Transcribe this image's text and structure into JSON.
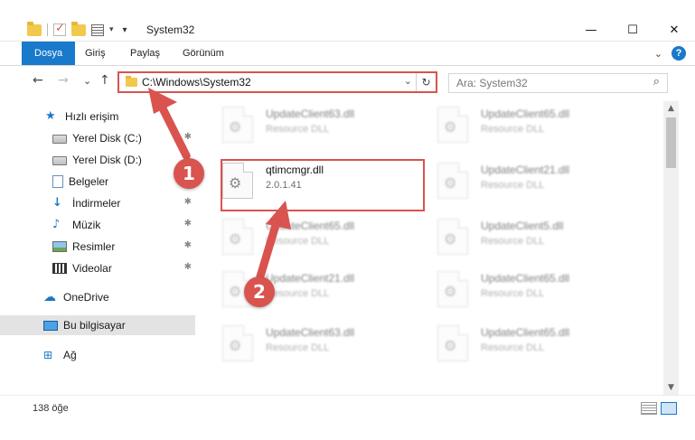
{
  "window": {
    "title": "System32",
    "minimize": "—",
    "maximize": "☐",
    "close": "✕"
  },
  "ribbon": {
    "tabs": [
      "Dosya",
      "Giriş",
      "Paylaş",
      "Görünüm"
    ],
    "help": "?",
    "expand": "⌄"
  },
  "nav": {
    "back": "←",
    "forward": "→",
    "recent": "⌄",
    "up": "↑",
    "address": "C:\\Windows\\System32",
    "address_dropdown": "⌄",
    "refresh": "↻",
    "search_placeholder": "Ara: System32",
    "search_icon": "⌕"
  },
  "sidebar": {
    "items": [
      {
        "label": "Hızlı erişim",
        "icon": "star-icon"
      },
      {
        "label": "Yerel Disk (C:)",
        "icon": "drive-icon",
        "pinned": true
      },
      {
        "label": "Yerel Disk (D:)",
        "icon": "drive-icon",
        "pinned": true
      },
      {
        "label": "Belgeler",
        "icon": "documents-icon",
        "pinned": true
      },
      {
        "label": "İndirmeler",
        "icon": "downloads-icon",
        "pinned": true
      },
      {
        "label": "Müzik",
        "icon": "music-icon",
        "pinned": true
      },
      {
        "label": "Resimler",
        "icon": "pictures-icon",
        "pinned": true
      },
      {
        "label": "Videolar",
        "icon": "videos-icon",
        "pinned": true
      },
      {
        "label": "OneDrive",
        "icon": "onedrive-icon"
      },
      {
        "label": "Bu bilgisayar",
        "icon": "this-pc-icon",
        "selected": true
      },
      {
        "label": "Ağ",
        "icon": "network-icon"
      }
    ],
    "pin_glyph": "📌"
  },
  "files": {
    "highlighted": {
      "name": "qtimcmgr.dll",
      "detail": "2.0.1.41"
    },
    "background": [
      {
        "name": "UpdateClient63.dll",
        "detail": "Resource DLL"
      },
      {
        "name": "UpdateClient65.dll",
        "detail": "Resource DLL"
      },
      {
        "name": "UpdateClient21.dll",
        "detail": "Resource DLL"
      },
      {
        "name": "UpdateClient65.dll",
        "detail": "Resource DLL"
      },
      {
        "name": "UpdateClient5.dll",
        "detail": "Resource DLL"
      },
      {
        "name": "UpdateClient21.dll",
        "detail": "Resource DLL"
      },
      {
        "name": "UpdateClient65.dll",
        "detail": "Resource DLL"
      },
      {
        "name": "UpdateClient63.dll",
        "detail": "Resource DLL"
      },
      {
        "name": "UpdateClient65.dll",
        "detail": "Resource DLL"
      }
    ]
  },
  "status": {
    "item_count": "138 öğe"
  },
  "annotations": {
    "step1": "1",
    "step2": "2",
    "color": "#d9534f"
  },
  "colors": {
    "accent": "#1979ca",
    "highlight": "#d9534f"
  }
}
